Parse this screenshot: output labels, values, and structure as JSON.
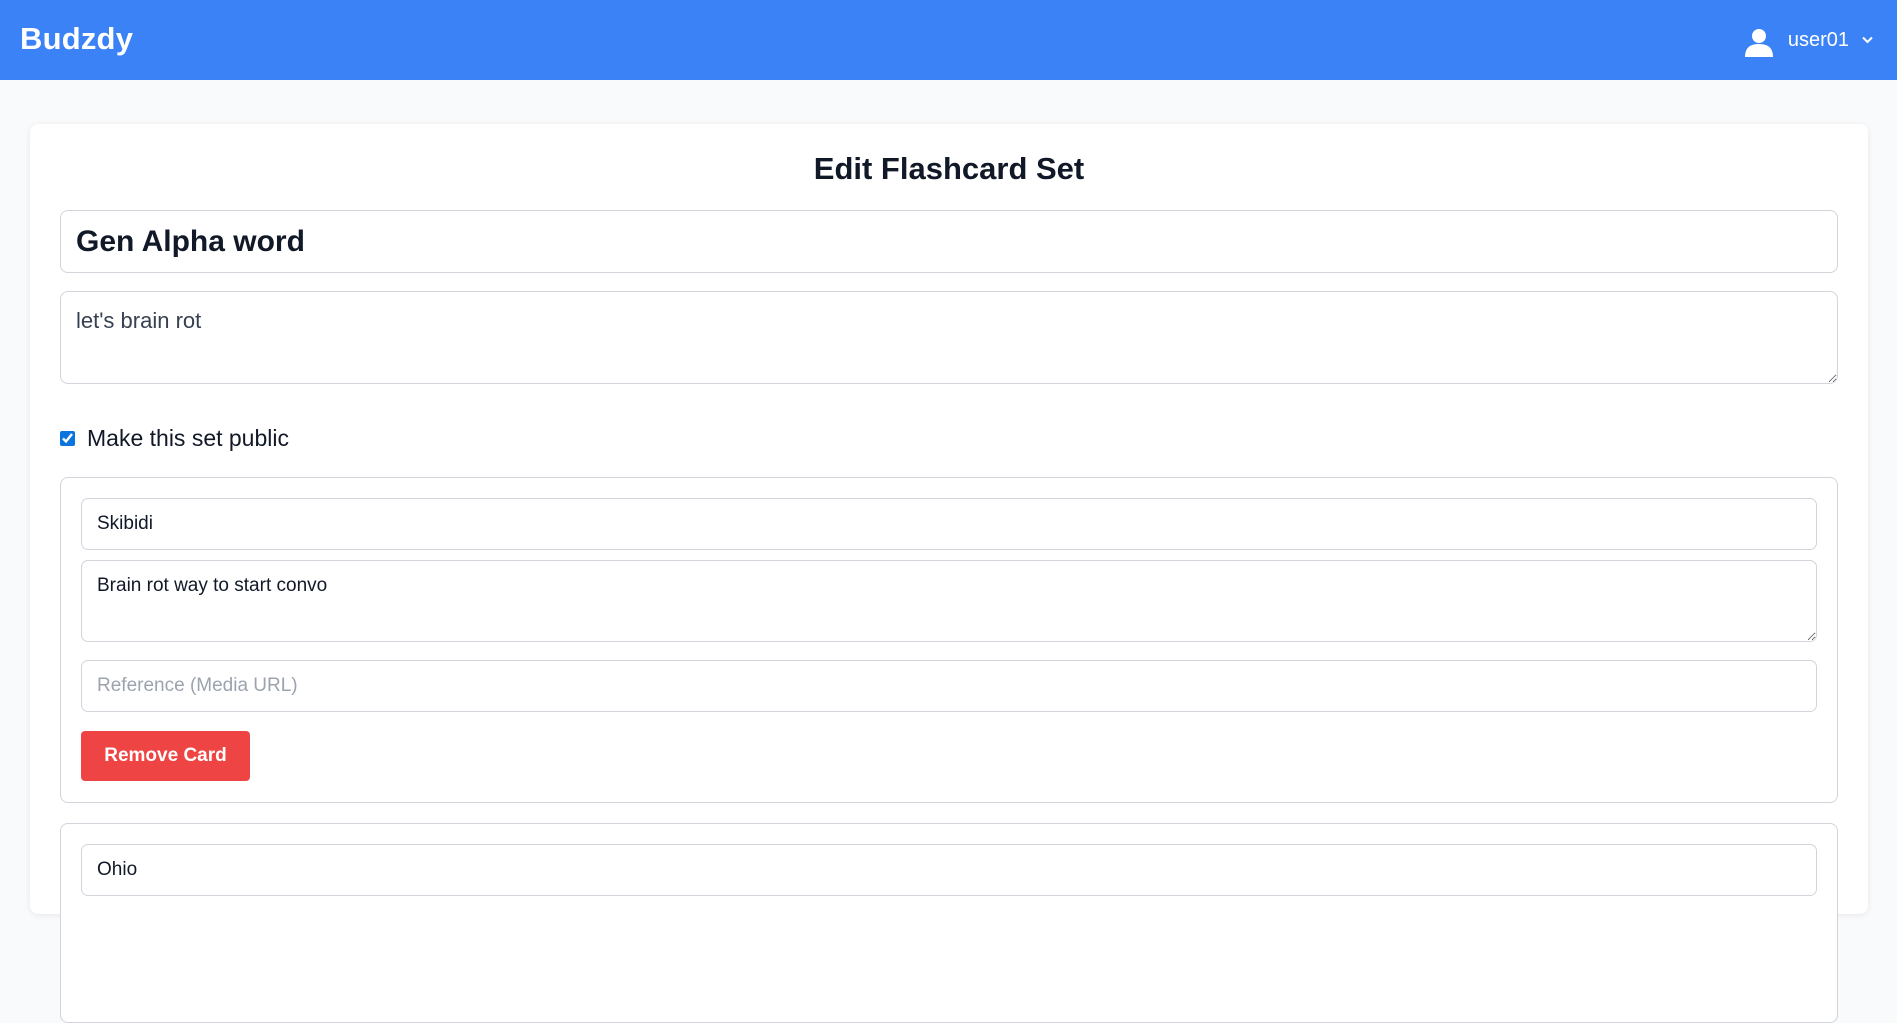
{
  "navbar": {
    "brand": "Budzdy",
    "user": {
      "icon": "user-icon",
      "name": "user01",
      "menu_icon": "chevron-down-icon"
    },
    "background": "#3b82f6"
  },
  "editor": {
    "title": "Edit Flashcard Set",
    "set_title_value": "Gen Alpha word",
    "set_description_value": "let's brain rot",
    "public_checkbox": {
      "label": "Make this set public",
      "checked": true
    }
  },
  "cards": [
    {
      "term": "Skibidi",
      "definition": "Brain rot way to start convo",
      "reference_value": "",
      "reference_placeholder": "Reference (Media URL)",
      "remove_label": "Remove Card"
    },
    {
      "term": "Ohio"
    }
  ],
  "colors": {
    "accent": "#3b82f6",
    "danger": "#ef4444",
    "border": "#d1d5db"
  }
}
